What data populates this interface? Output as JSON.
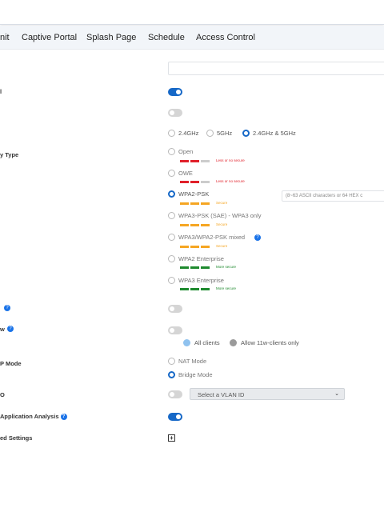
{
  "tabs": [
    {
      "label": "nit"
    },
    {
      "label": "Captive Portal"
    },
    {
      "label": "Splash Page"
    },
    {
      "label": "Schedule"
    },
    {
      "label": "Access Control"
    }
  ],
  "labels": {
    "security_type": "y Type",
    "help_a": "",
    "w": "w",
    "p_mode": "P Mode",
    "o": "O",
    "app_analysis": "Application Analysis",
    "advanced": "ed Settings",
    "l": "l"
  },
  "band": {
    "options": [
      "2.4GHz",
      "5GHz",
      "2.4GHz & 5GHz"
    ],
    "selected": "2.4GHz & 5GHz"
  },
  "security": {
    "options": [
      {
        "label": "Open",
        "strength": "Less or no secure",
        "color": "#e0202a"
      },
      {
        "label": "OWE",
        "strength": "Less or no secure",
        "color": "#e0202a"
      },
      {
        "label": "WPA2-PSK",
        "strength": "Secure",
        "color": "#f5a623"
      },
      {
        "label": "WPA3-PSK (SAE) - WPA3 only",
        "strength": "Secure",
        "color": "#f5a623"
      },
      {
        "label": "WPA3/WPA2-PSK mixed",
        "strength": "Secure",
        "color": "#f5a623"
      },
      {
        "label": "WPA2 Enterprise",
        "strength": "More secure",
        "color": "#1e8a2e"
      },
      {
        "label": "WPA3 Enterprise",
        "strength": "More secure",
        "color": "#1e8a2e"
      }
    ],
    "selected": "WPA2-PSK",
    "psk_placeholder": "(8~63 ASCII characters or 64 HEX c"
  },
  "clients": {
    "options": [
      "All clients",
      "Allow 11w-clients only"
    ]
  },
  "mode": {
    "options": [
      "NAT Mode",
      "Bridge Mode"
    ],
    "selected": "Bridge Mode"
  },
  "vlan": {
    "placeholder": "Select a VLAN ID"
  },
  "colors": {
    "accent": "#1668c7",
    "weak": "#e0202a",
    "medium": "#f5a623",
    "strong": "#1e8a2e"
  }
}
